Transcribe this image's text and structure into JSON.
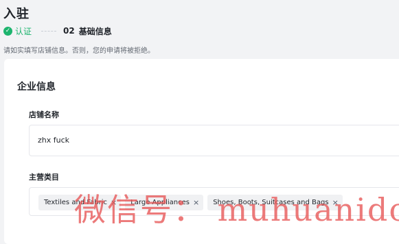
{
  "page": {
    "title": "入驻",
    "hint": "请如实填写店铺信息。否则，您的申请将被拒绝。"
  },
  "steps": [
    {
      "label": "认证",
      "status": "done"
    },
    {
      "number": "02",
      "label": "基础信息",
      "status": "current"
    }
  ],
  "form": {
    "section_title": "企业信息",
    "shop_name": {
      "label": "店铺名称",
      "value": "zhx fuck"
    },
    "category": {
      "label": "主营类目",
      "tags": [
        {
          "label": "Textiles and Fabric",
          "remove": "×"
        },
        {
          "label": "Large Appliances",
          "remove": "×"
        },
        {
          "label": "Shoes, Boots, Suitcases and Bags",
          "remove": "×"
        }
      ]
    }
  },
  "watermark": "微信号： muhuanidc",
  "colors": {
    "success": "#1db46e",
    "watermark": "#e75454",
    "background": "#f2f3f5"
  }
}
